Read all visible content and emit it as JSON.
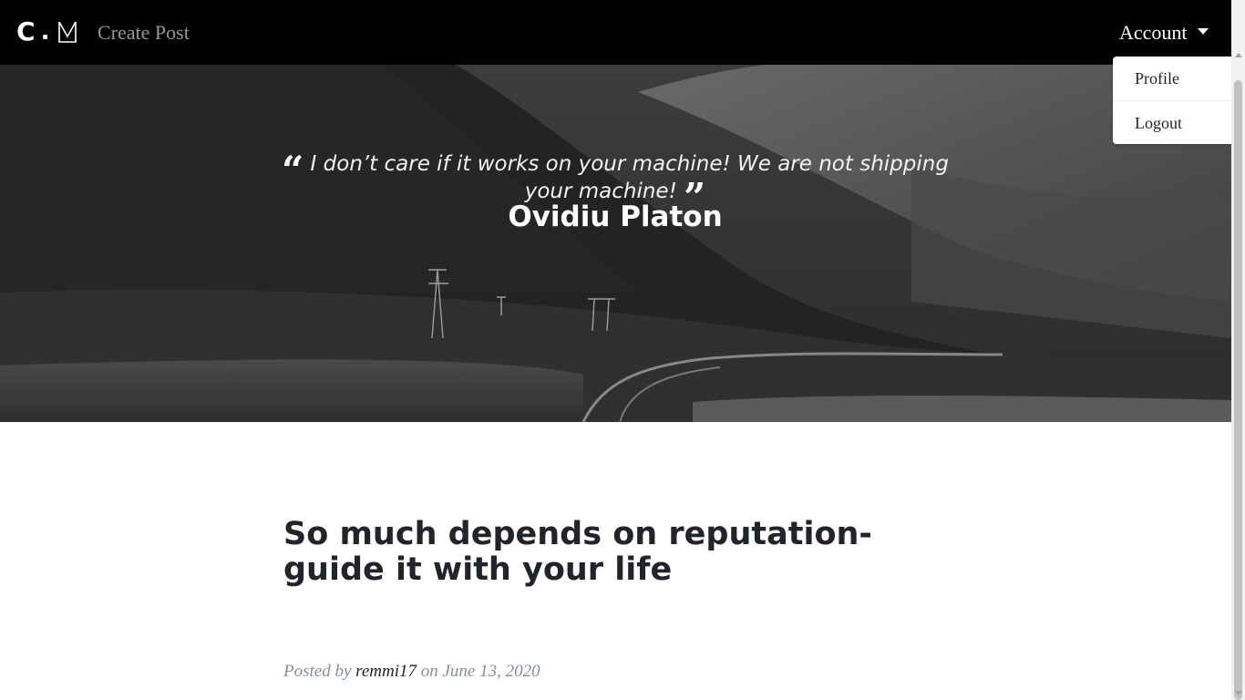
{
  "navbar": {
    "logo_letter": "C",
    "logo_dot": ".",
    "create_post": "Create Post",
    "account": "Account"
  },
  "dropdown": {
    "items": [
      "Profile",
      "Logout"
    ]
  },
  "hero": {
    "quote": "I don’t care if it works on your machine! We are not shipping your machine!",
    "author": "Ovidiu Platon"
  },
  "post": {
    "title": "So much depends on reputation-guide it with your life",
    "meta_prefix": "Posted by",
    "author": "remmi17",
    "meta_middle": "on",
    "date": "June 13, 2020"
  }
}
